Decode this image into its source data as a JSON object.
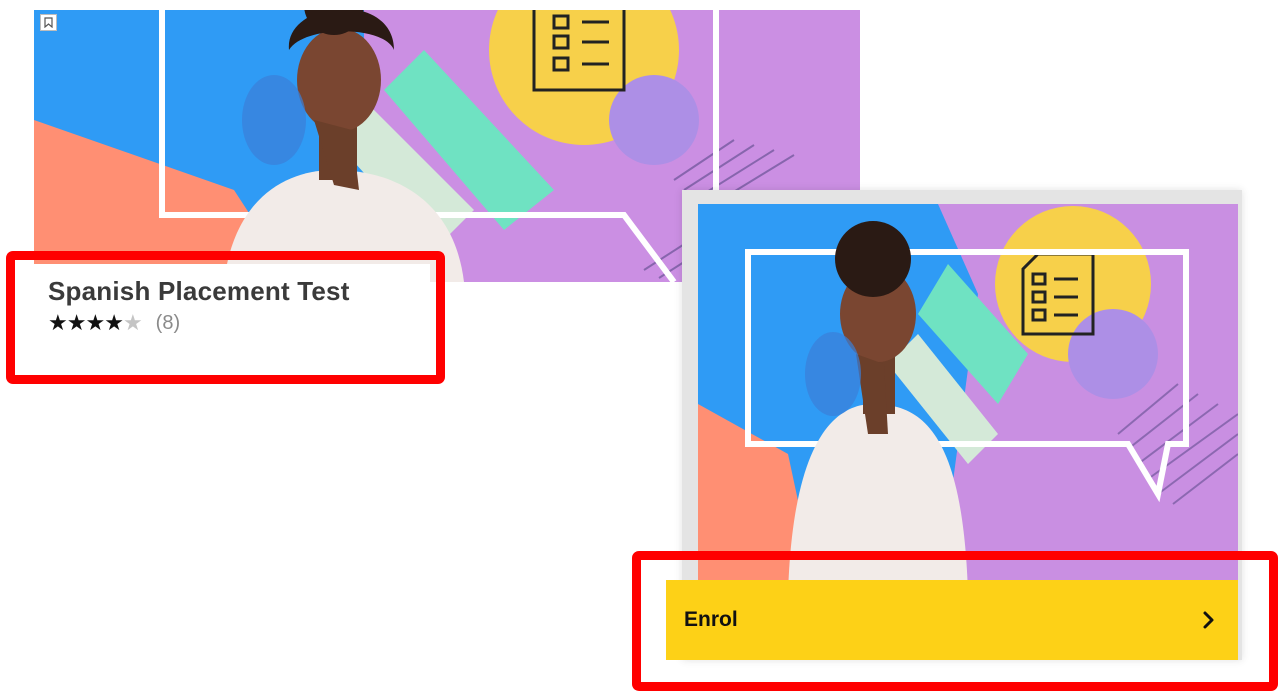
{
  "course": {
    "title": "Spanish Placement Test",
    "rating": 4,
    "rating_max": 5,
    "review_count": "(8)"
  },
  "actions": {
    "enrol_label": "Enrol",
    "enrol_icon": "chevron-right-icon",
    "bookmark_icon": "bookmark-icon"
  },
  "colors": {
    "enrol_button": "#fdd117",
    "highlight": "#ff0000",
    "title_text": "#3a3a3a"
  }
}
